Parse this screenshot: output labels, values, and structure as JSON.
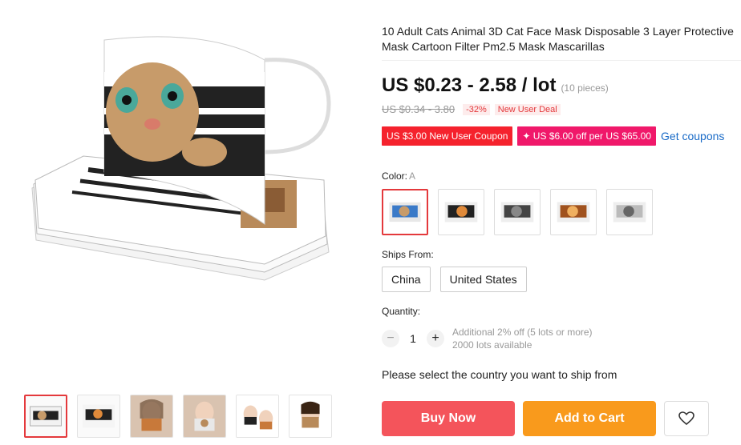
{
  "product": {
    "title": "10 Adult Cats Animal 3D Cat Face Mask Disposable 3 Layer Protective Mask Cartoon Filter Pm2.5 Mask Mascarillas",
    "price": "US $0.23 - 2.58 / lot",
    "pieces": "(10 pieces)",
    "original_price": "US $0.34 - 3.80",
    "discount": "-32%",
    "deal_label": "New User Deal"
  },
  "coupons": {
    "new_user": "US $3.00 New User Coupon",
    "off": "✦ US $6.00 off per US $65.00",
    "get": "Get coupons"
  },
  "color": {
    "label": "Color:",
    "selected": "A",
    "options": [
      "A",
      "B",
      "C",
      "D",
      "E"
    ]
  },
  "ships_from": {
    "label": "Ships From:",
    "options": [
      "China",
      "United States"
    ]
  },
  "quantity": {
    "label": "Quantity:",
    "minus": "−",
    "value": "1",
    "plus": "+",
    "note_line1": "Additional 2% off (5 lots or more)",
    "note_line2": "2000 lots available"
  },
  "ship_note": "Please select the country you want to ship from",
  "actions": {
    "buy": "Buy Now",
    "cart": "Add to Cart"
  },
  "icons": {
    "wishlist": "heart-icon"
  },
  "colors": {
    "accent": "#e4393c",
    "buy": "#f4545b",
    "cart": "#f99a1c",
    "link": "#1a6bc7",
    "coupon": "#f5222d",
    "coupon_pink": "#f0186a"
  }
}
